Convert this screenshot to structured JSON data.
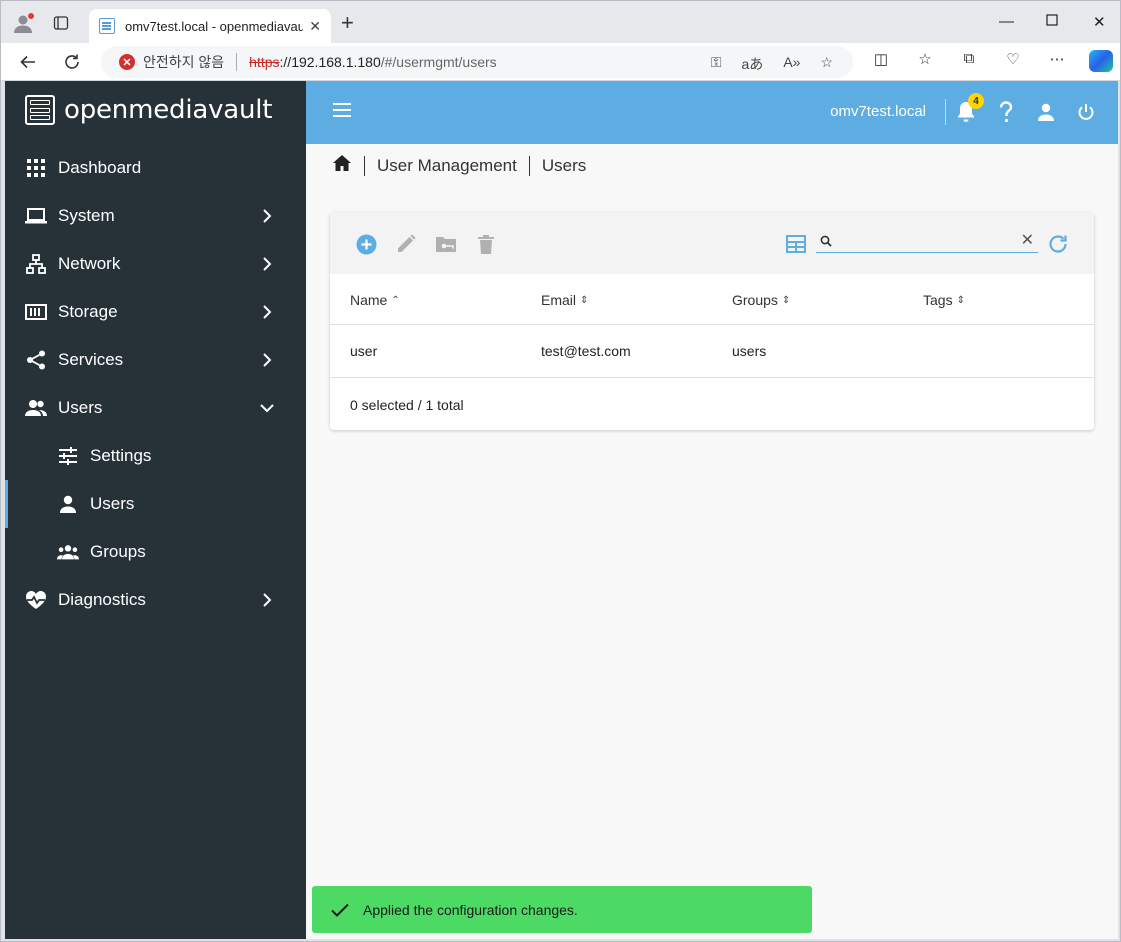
{
  "browser": {
    "tab_title": "omv7test.local - openmediavault",
    "url_warning": "안전하지 않음",
    "url_protocol": "https",
    "url_host": "://192.168.1.180",
    "url_path": "/#/usermgmt/users"
  },
  "sidebar": {
    "logo_text": "openmediavault",
    "items": [
      {
        "label": "Dashboard",
        "icon": "dashboard-icon"
      },
      {
        "label": "System",
        "icon": "laptop-icon"
      },
      {
        "label": "Network",
        "icon": "network-icon"
      },
      {
        "label": "Storage",
        "icon": "storage-icon"
      },
      {
        "label": "Services",
        "icon": "share-icon"
      },
      {
        "label": "Users",
        "icon": "users-icon"
      },
      {
        "label": "Settings",
        "icon": "tune-icon"
      },
      {
        "label": "Users",
        "icon": "user-icon"
      },
      {
        "label": "Groups",
        "icon": "groups-icon"
      },
      {
        "label": "Diagnostics",
        "icon": "heart-pulse-icon"
      }
    ]
  },
  "topbar": {
    "hostname": "omv7test.local",
    "notification_count": "4"
  },
  "breadcrumb": {
    "items": [
      "User Management",
      "Users"
    ]
  },
  "table": {
    "columns": [
      "Name",
      "Email",
      "Groups",
      "Tags"
    ],
    "rows": [
      {
        "name": "user",
        "email": "test@test.com",
        "groups": "users",
        "tags": ""
      }
    ],
    "footer": "0 selected / 1 total",
    "search_value": ""
  },
  "toast": {
    "message": "Applied the configuration changes.",
    "color": "#4cd964"
  },
  "colors": {
    "accent": "#5dade2",
    "sidebar_bg": "#263238"
  }
}
